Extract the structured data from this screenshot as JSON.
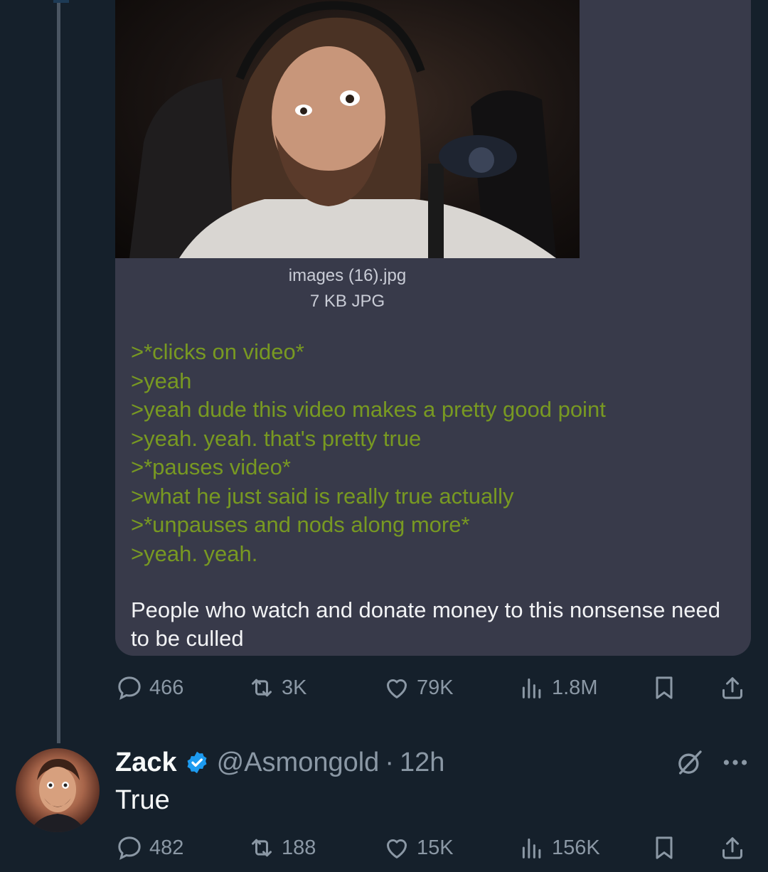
{
  "post": {
    "file_name": "images (16).jpg",
    "file_size": "7 KB JPG",
    "greentext": [
      ">*clicks on video*",
      ">yeah",
      ">yeah dude this video makes a pretty good point",
      ">yeah. yeah. that's pretty true",
      ">*pauses video*",
      ">what he just said is really true actually",
      ">*unpauses and nods along more*",
      ">yeah. yeah."
    ],
    "caption": "People who watch and donate money to this nonsense need to be culled",
    "stats": {
      "replies": "466",
      "reposts": "3K",
      "likes": "79K",
      "views": "1.8M"
    }
  },
  "reply": {
    "display_name": "Zack",
    "handle": "@Asmongold",
    "separator": "·",
    "time": "12h",
    "text": "True",
    "stats": {
      "replies": "482",
      "reposts": "188",
      "likes": "15K",
      "views": "156K"
    }
  },
  "colors": {
    "background": "#15202b",
    "card": "#383a4a",
    "greentext": "#789922",
    "muted": "#8b98a5",
    "verified": "#1d9bf0"
  }
}
